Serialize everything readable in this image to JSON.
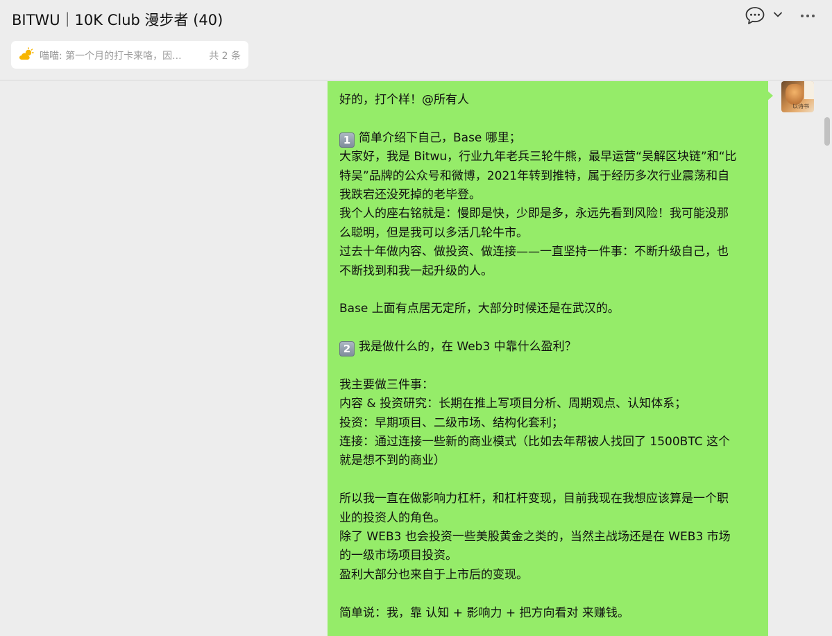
{
  "window": {
    "title": "BITWU｜10K Club 漫步者 (40)"
  },
  "pinned": {
    "text": "喵喵: 第一个月的打卡来咯，因...",
    "count": "共 2 条"
  },
  "avatar": {
    "tag": "以诗书"
  },
  "message": {
    "lines": [
      "好的，打个样！@所有人",
      "",
      "简单介绍下自己，Base 哪里；",
      "大家好，我是 Bitwu，行业九年老兵三轮牛熊，最早运营“吴解区块链”和“比",
      "特吴”品牌的公众号和微博，2021年转到推特，属于经历多次行业震荡和自",
      "我跌宕还没死掉的老毕登。",
      "我个人的座右铭就是：慢即是快，少即是多，永远先看到风险！我可能没那",
      "么聪明，但是我可以多活几轮牛市。",
      "过去十年做内容、做投资、做连接——一直坚持一件事：不断升级自己，也",
      "不断找到和我一起升级的人。",
      "",
      "Base 上面有点居无定所，大部分时候还是在武汉的。",
      "",
      "我是做什么的，在 Web3 中靠什么盈利？",
      "",
      "我主要做三件事：",
      "内容 & 投资研究：长期在推上写项目分析、周期观点、认知体系；",
      "投资：早期项目、二级市场、结构化套利；",
      "连接：通过连接一些新的商业模式（比如去年帮被人找回了 1500BTC 这个",
      "就是想不到的商业）",
      "",
      "所以我一直在做影响力杠杆，和杠杆变现，目前我现在我想应该算是一个职",
      "业的投资人的角色。",
      "除了 WEB3 也会投资一些美股黄金之类的，当然主战场还是在 WEB3 市场",
      "的一级市场项目投资。",
      "盈利大部分也来自于上市后的变现。",
      "",
      "简单说：我，靠 认知 + 影响力 + 把方向看对 来赚钱。"
    ],
    "badges": {
      "2": "1",
      "13": "2"
    }
  },
  "icons": {
    "chat": "chat-bubble-icon",
    "chevron": "chevron-down-icon",
    "more": "more-dots-icon",
    "pin": "sun-cloud-icon"
  }
}
